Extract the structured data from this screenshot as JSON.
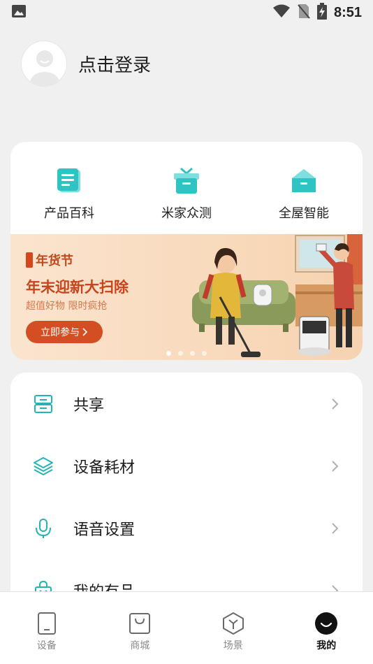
{
  "status_bar": {
    "time": "8:51",
    "icons": [
      "image-icon",
      "wifi-icon",
      "no-sim-icon",
      "battery-charging-icon"
    ]
  },
  "profile": {
    "login_label": "点击登录"
  },
  "shortcuts": [
    {
      "label": "产品百科",
      "icon": "encyclopedia-icon"
    },
    {
      "label": "米家众测",
      "icon": "gift-box-icon"
    },
    {
      "label": "全屋智能",
      "icon": "smart-home-icon"
    }
  ],
  "banner": {
    "tag": "年货节",
    "title": "年末迎新大扫除",
    "subtitle": "超值好物 限时疯抢",
    "button": "立即参与",
    "slide_count": 4,
    "active_slide": 1
  },
  "menu": [
    {
      "label": "共享",
      "icon": "share-device-icon"
    },
    {
      "label": "设备耗材",
      "icon": "layers-icon"
    },
    {
      "label": "语音设置",
      "icon": "microphone-icon"
    },
    {
      "label": "我的有品",
      "icon": "shopping-bag-icon"
    }
  ],
  "bottom_nav": [
    {
      "label": "设备",
      "icon": "device-icon"
    },
    {
      "label": "商城",
      "icon": "mall-bag-icon"
    },
    {
      "label": "场景",
      "icon": "scene-cube-icon"
    },
    {
      "label": "我的",
      "icon": "profile-face-icon",
      "active": true
    }
  ],
  "colors": {
    "accent_teal": "#2ec4c4",
    "banner_red": "#d34f23",
    "background": "#f0f0f0"
  }
}
